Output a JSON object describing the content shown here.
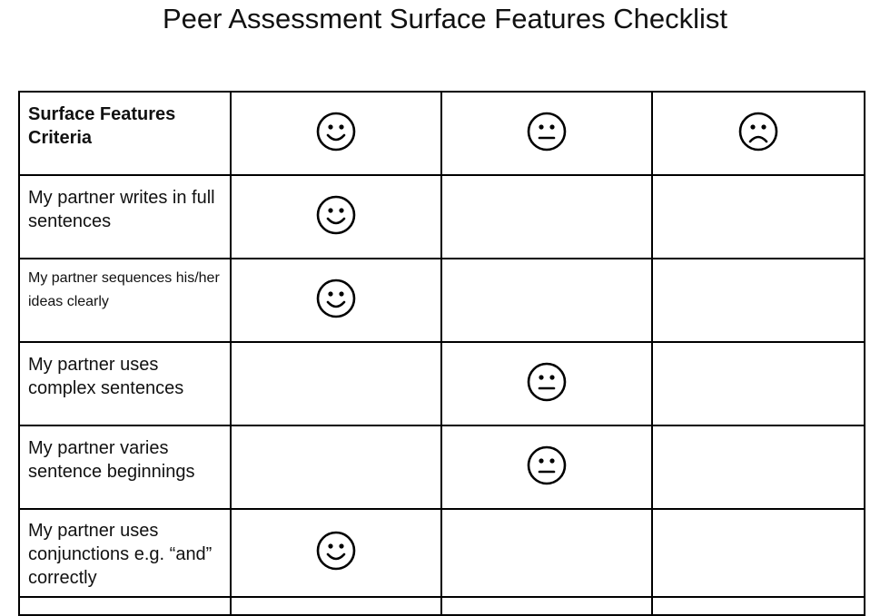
{
  "title": "Peer Assessment Surface Features Checklist",
  "header": {
    "criteria_label": "Surface Features Criteria",
    "columns": [
      {
        "icon": "smiley-happy-icon",
        "meaning": "good"
      },
      {
        "icon": "smiley-neutral-icon",
        "meaning": "okay"
      },
      {
        "icon": "smiley-sad-icon",
        "meaning": "needs work"
      }
    ]
  },
  "rows": [
    {
      "criterion": "My partner writes in full sentences",
      "rating": "happy"
    },
    {
      "criterion": "My partner sequences his/her ideas clearly",
      "rating": "happy"
    },
    {
      "criterion": "My partner uses complex sentences",
      "rating": "neutral"
    },
    {
      "criterion": "My partner varies sentence beginnings",
      "rating": "neutral"
    },
    {
      "criterion": "My partner uses conjunctions e.g. “and” correctly",
      "rating": "happy"
    }
  ]
}
